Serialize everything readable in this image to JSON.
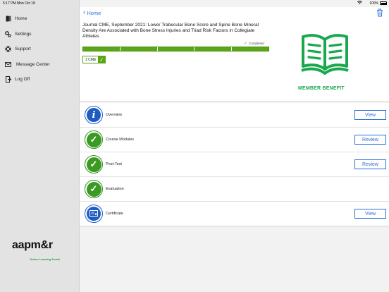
{
  "status_bar": {
    "time": "5:17 PM",
    "date": "Mon Oct 18",
    "battery": "100%"
  },
  "sidebar": {
    "items": [
      {
        "label": "Home",
        "icon": "home-icon"
      },
      {
        "label": "Settings",
        "icon": "gear-icon"
      },
      {
        "label": "Support",
        "icon": "support-icon"
      },
      {
        "label": "Message Center",
        "icon": "envelope-icon"
      },
      {
        "label": "Log Off",
        "icon": "logout-icon"
      }
    ],
    "logo": "aapm&r",
    "logo_sub": "Online Learning Portal"
  },
  "header": {
    "back_label": "Home"
  },
  "course": {
    "title": "Journal CME, September 2021: Lower Trabecular Bone Score and Spine Bone Mineral Density Are Associated with Bone Stress Injuries and Triad Risk Factors in Collegiate Athletes",
    "status": "Completed",
    "progress": 1.0,
    "cme_label": "1 CME",
    "benefit_label": "MEMBER BENEFIT"
  },
  "modules": [
    {
      "label": "Overview",
      "icon": "info-icon",
      "action": "View"
    },
    {
      "label": "Course Modules",
      "icon": "check-icon",
      "action": "Review"
    },
    {
      "label": "Post-Test",
      "icon": "check-icon",
      "action": "Review"
    },
    {
      "label": "Evaluation",
      "icon": "check-icon",
      "action": ""
    },
    {
      "label": "Certificate",
      "icon": "certificate-icon",
      "action": "View"
    }
  ],
  "colors": {
    "accent_blue": "#2a6fd6",
    "progress_green": "#59a714",
    "benefit_green": "#1aa84f",
    "sidebar_bg": "#e3e3e3"
  }
}
